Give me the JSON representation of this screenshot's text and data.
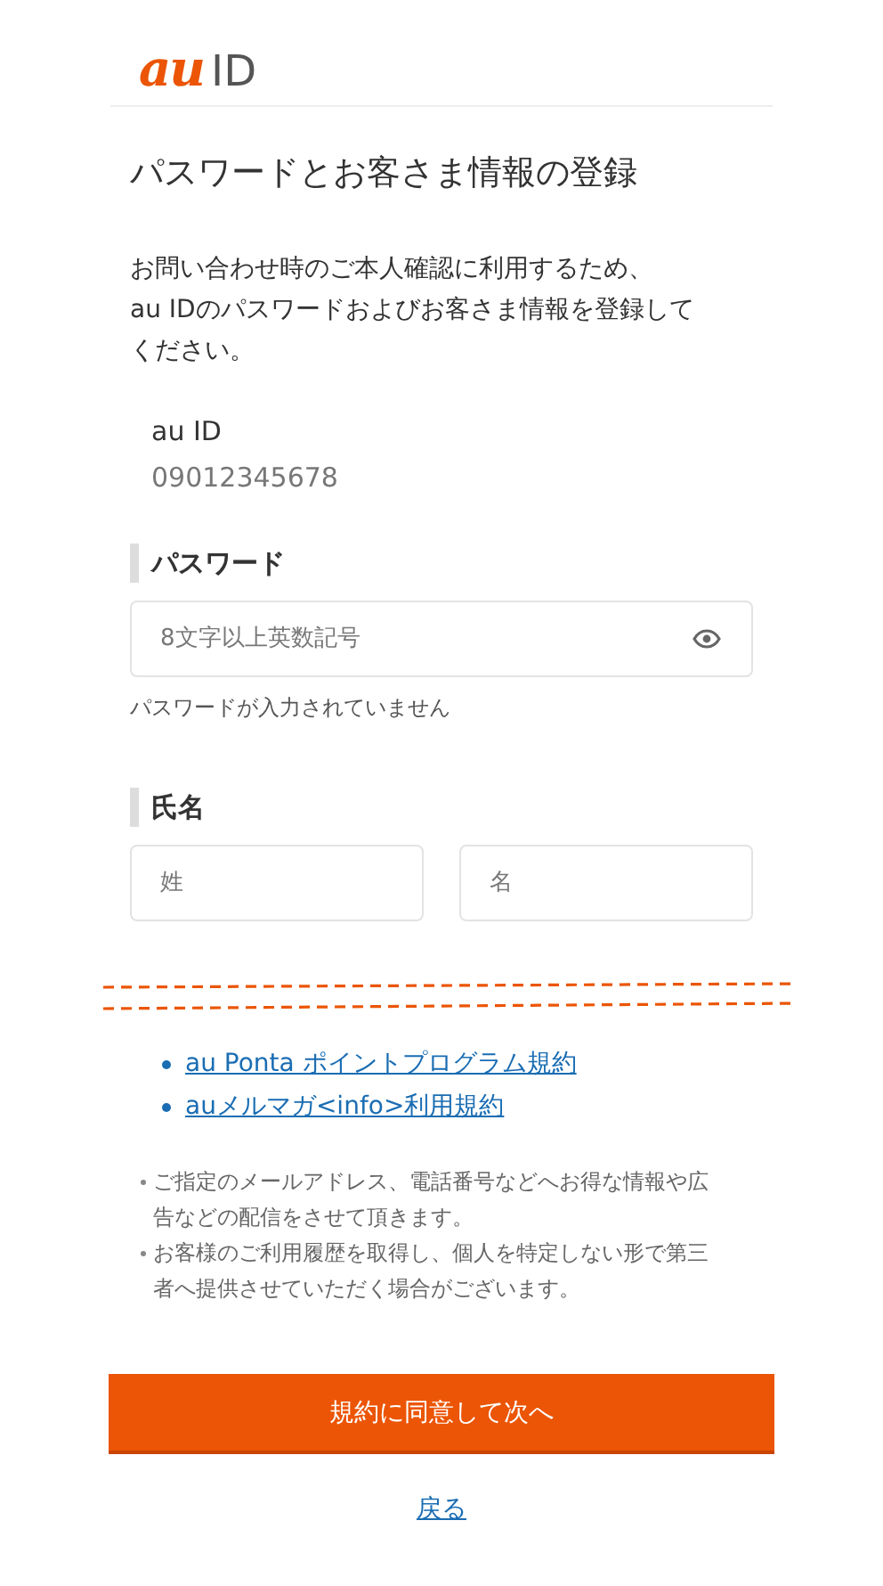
{
  "logo": {
    "brand": "au",
    "suffix": "ID"
  },
  "title": "パスワードとお客さま情報の登録",
  "intro": [
    "お問い合わせ時のご本人確認に利用するため、",
    "au IDのパスワードおよびお客さま情報を登録して",
    "ください。"
  ],
  "au_id": {
    "label": "au ID",
    "value": "09012345678"
  },
  "password": {
    "label": "パスワード",
    "placeholder": "8文字以上英数記号",
    "error": "パスワードが入力されていません"
  },
  "name": {
    "label": "氏名",
    "fields": [
      {
        "placeholder": "姓"
      },
      {
        "placeholder": "名"
      }
    ]
  },
  "terms_links": [
    "au Ponta ポイントプログラム規約",
    "auメルマガ<info>利用規約"
  ],
  "notes": [
    "ご指定のメールアドレス、電話番号などへお得な情報や広告などの配信をさせて頂きます。",
    "お客様のご利用履歴を取得し、個人を特定しない形で第三者へ提供させていただく場合がございます。"
  ],
  "submit": "規約に同意して次へ",
  "back": "戻る"
}
